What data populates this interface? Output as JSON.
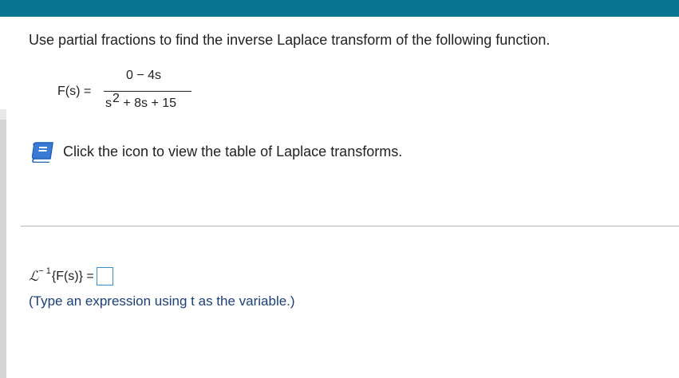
{
  "question": "Use partial fractions to find the inverse Laplace transform of the following function.",
  "function": {
    "label": "F(s) =",
    "numerator": "0 − 4s",
    "denominator_base": "s",
    "denominator_exp": "2",
    "denominator_rest": " + 8s + 15"
  },
  "instruction": "Click the icon to view the table of Laplace transforms.",
  "answer": {
    "operator": "ℒ",
    "superscript": "− 1",
    "argument": "{F(s)} =",
    "value": ""
  },
  "hint": "(Type an expression using t as the variable.)",
  "colors": {
    "topbar": "#0a7593",
    "book_icon": "#3a7bd5",
    "answer_box_border": "#3a8fd0",
    "hint_text": "#1b3f7a"
  },
  "icons": {
    "table": "book-icon"
  }
}
